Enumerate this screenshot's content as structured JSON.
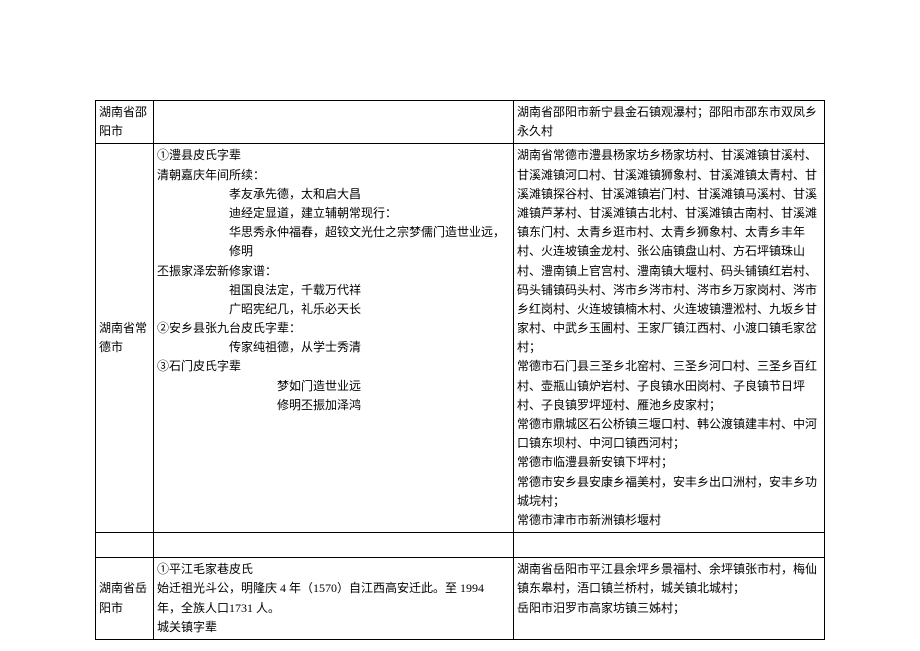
{
  "rows": [
    {
      "region": "湖南省邵阳市",
      "middle": "",
      "right": "湖南省邵阳市新宁县金石镇观瀑村；邵阳市邵东市双凤乡永久村"
    },
    {
      "region": "湖南省常德市",
      "middle_lines": [
        {
          "t": "①澧县皮氏字辈",
          "cls": ""
        },
        {
          "t": "清朝嘉庆年间所续：",
          "cls": ""
        },
        {
          "t": "孝友承先德，太和启大昌",
          "cls": "indent1"
        },
        {
          "t": "迪经定显道，建立辅朝常现行：",
          "cls": "indent1"
        },
        {
          "t": "华思秀永仲福春，超铰文光仕之宗梦儒门造世业远，修明",
          "cls": "indent1"
        },
        {
          "t": "丕振家泽宏新修家谱：",
          "cls": ""
        },
        {
          "t": "祖国良法定，千载万代祥",
          "cls": "indent1"
        },
        {
          "t": "广昭宪纪几，礼乐必天长",
          "cls": "indent1"
        },
        {
          "t": "②安乡县张九台皮氏字辈：",
          "cls": ""
        },
        {
          "t": "传家纯祖德，从学士秀清",
          "cls": "indent1"
        },
        {
          "t": "③石门皮氏字辈",
          "cls": ""
        },
        {
          "t": "梦如门造世业远",
          "cls": "indent2"
        },
        {
          "t": "修明丕振加泽鸿",
          "cls": "indent2"
        }
      ],
      "right": "湖南省常德市澧县杨家坊乡杨家坊村、甘溪滩镇甘溪村、甘溪滩镇河口村、甘溪滩镇狮象村、甘溪滩镇太青村、甘溪滩镇探谷村、甘溪滩镇岩门村、甘溪滩镇马溪村、甘溪滩镇芦茅村、甘溪滩镇古北村、甘溪滩镇古南村、甘溪滩镇东门村、太青乡逛市村、太青乡狮象村、太青乡丰年村、火连坡镇金龙村、张公庙镇盘山村、方石坪镇珠山村、澧南镇上官宫村、澧南镇大堰村、码头铺镇红岩村、码头铺镇码头村、涔市乡涔市村、涔市乡万家岗村、涔市乡红岗村、火连坡镇楠木村、火连坡镇澧淞村、九坂乡甘家村、中武乡玉圃村、王家厂镇江西村、小渡口镇毛家岔村；\n常德市石门县三圣乡北窑村、三圣乡河口村、三圣乡百红村、壶瓶山镇炉岩村、子良镇水田岗村、子良镇节日坪村、子良镇罗坪垭村、雁池乡皮家村；\n常德市鼎城区石公桥镇三堰口村、韩公渡镇建丰村、中河口镇东坝村、中河口镇西河村；\n常德市临澧县新安镇下坪村；\n常德市安乡县安康乡福美村，安丰乡出口洲村，安丰乡功城垸村；\n常德市津市市新洲镇杉堰村"
    },
    {
      "region": "",
      "middle": "",
      "right": ""
    },
    {
      "region": "湖南省岳阳市",
      "middle": "①平江毛家巷皮氏\n始迁祖光斗公，明隆庆 4 年（1570）自江西高安迁此。至 1994 年，全族人口1731 人。\n城关镇字辈",
      "right": "湖南省岳阳市平江县余坪乡景福村、余坪镇张市村，梅仙镇东皋村，浯口镇兰桥村，城关镇北城村；\n岳阳市汨罗市高家坊镇三姊村；"
    }
  ]
}
